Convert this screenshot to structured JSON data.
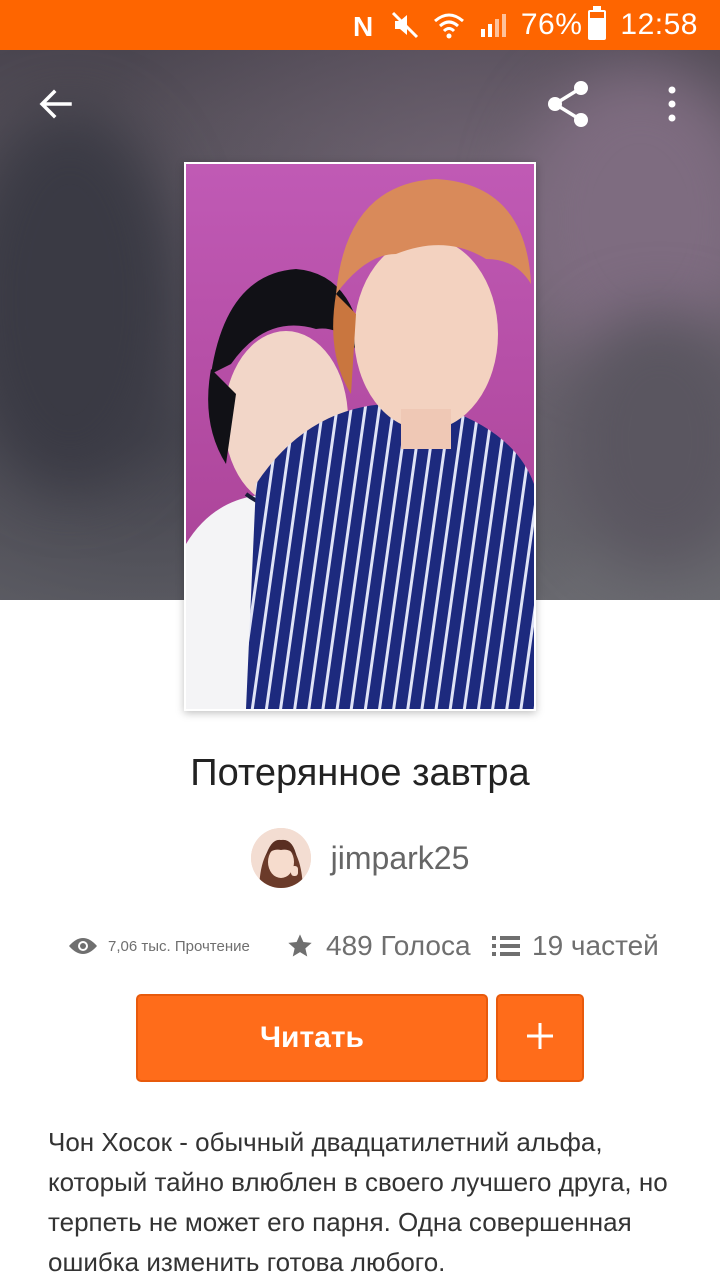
{
  "status_bar": {
    "battery": "76%",
    "time": "12:58",
    "battery_level": 0.76,
    "icons": [
      "nfc-icon",
      "mute-icon",
      "wifi-icon",
      "signal-icon",
      "battery-icon"
    ]
  },
  "toolbar": {
    "back_icon": "arrow-left-icon",
    "share_icon": "share-icon",
    "more_icon": "more-vert-icon"
  },
  "story": {
    "title": "Потерянное завтра",
    "author": "jimpark25",
    "reads": "7,06 тыс. Прочтение",
    "votes": "489 Голоса",
    "parts": "19 частей",
    "read_button": "Читать",
    "add_button": "+",
    "description": "Чон Хосок - обычный двадцатилетний альфа, который тайно влюблен в своего лучшего друга, но терпеть не может его парня. Одна совершенная ошибка изменить готова любого."
  },
  "colors": {
    "brand": "#fe6500",
    "button": "#ff6c1a"
  }
}
